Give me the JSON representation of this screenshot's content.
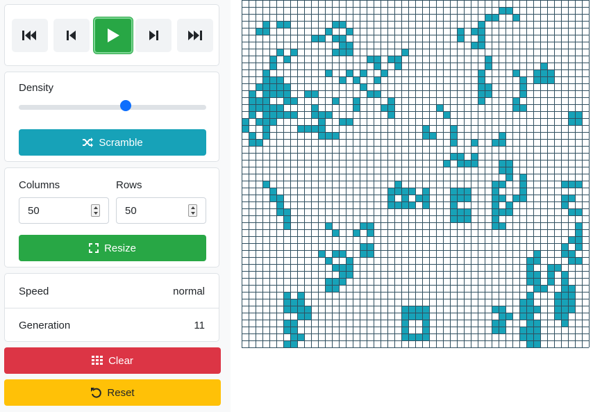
{
  "controls": {
    "icons": [
      "skip-to-start-icon",
      "step-back-icon",
      "play-icon",
      "step-forward-icon",
      "fast-forward-icon"
    ]
  },
  "density": {
    "label": "Density",
    "value_fraction": 0.57,
    "scramble_label": "Scramble"
  },
  "size": {
    "columns_label": "Columns",
    "rows_label": "Rows",
    "columns_value": "50",
    "rows_value": "50",
    "resize_label": "Resize"
  },
  "stats": {
    "speed_label": "Speed",
    "speed_value": "normal",
    "generation_label": "Generation",
    "generation_value": "11"
  },
  "actions": {
    "clear_label": "Clear",
    "reset_label": "Reset"
  },
  "colors": {
    "live_cell": "#17a2b8",
    "grid_line": "#2f4f5f",
    "play_active": "#28a745",
    "scramble": "#17a2b8",
    "resize": "#28a745",
    "clear": "#dc3545",
    "reset": "#ffc107"
  },
  "grid": {
    "columns": 50,
    "rows": 50,
    "live_cells": [
      [
        1,
        37
      ],
      [
        1,
        38
      ],
      [
        2,
        35
      ],
      [
        2,
        36
      ],
      [
        2,
        39
      ],
      [
        3,
        3
      ],
      [
        3,
        5
      ],
      [
        3,
        6
      ],
      [
        3,
        13
      ],
      [
        3,
        14
      ],
      [
        3,
        34
      ],
      [
        4,
        2
      ],
      [
        4,
        3
      ],
      [
        4,
        12
      ],
      [
        4,
        15
      ],
      [
        4,
        31
      ],
      [
        4,
        33
      ],
      [
        4,
        34
      ],
      [
        5,
        10
      ],
      [
        5,
        11
      ],
      [
        5,
        13
      ],
      [
        5,
        14
      ],
      [
        5,
        31
      ],
      [
        5,
        34
      ],
      [
        6,
        14
      ],
      [
        6,
        15
      ],
      [
        6,
        33
      ],
      [
        6,
        34
      ],
      [
        7,
        5
      ],
      [
        7,
        7
      ],
      [
        7,
        13
      ],
      [
        7,
        14
      ],
      [
        7,
        15
      ],
      [
        7,
        23
      ],
      [
        8,
        4
      ],
      [
        8,
        6
      ],
      [
        8,
        18
      ],
      [
        8,
        19
      ],
      [
        8,
        21
      ],
      [
        8,
        22
      ],
      [
        8,
        35
      ],
      [
        9,
        4
      ],
      [
        9,
        19
      ],
      [
        9,
        22
      ],
      [
        9,
        35
      ],
      [
        10,
        3
      ],
      [
        10,
        12
      ],
      [
        10,
        15
      ],
      [
        10,
        17
      ],
      [
        10,
        20
      ],
      [
        10,
        34
      ],
      [
        10,
        39
      ],
      [
        10,
        42
      ],
      [
        10,
        43
      ],
      [
        11,
        3
      ],
      [
        11,
        4
      ],
      [
        11,
        5
      ],
      [
        11,
        14
      ],
      [
        11,
        16
      ],
      [
        11,
        19
      ],
      [
        11,
        34
      ],
      [
        11,
        40
      ],
      [
        11,
        42
      ],
      [
        11,
        43
      ],
      [
        12,
        3
      ],
      [
        12,
        4
      ],
      [
        12,
        5
      ],
      [
        12,
        17
      ],
      [
        12,
        34
      ],
      [
        12,
        35
      ],
      [
        12,
        40
      ],
      [
        13,
        1
      ],
      [
        13,
        3
      ],
      [
        13,
        4
      ],
      [
        13,
        5
      ],
      [
        13,
        6
      ],
      [
        13,
        9
      ],
      [
        13,
        10
      ],
      [
        13,
        18
      ],
      [
        13,
        19
      ],
      [
        13,
        34
      ],
      [
        13,
        35
      ],
      [
        13,
        40
      ],
      [
        14,
        1
      ],
      [
        14,
        3
      ],
      [
        14,
        6
      ],
      [
        14,
        7
      ],
      [
        14,
        13
      ],
      [
        14,
        16
      ],
      [
        14,
        21
      ],
      [
        14,
        34
      ],
      [
        14,
        39
      ],
      [
        15,
        1
      ],
      [
        15,
        2
      ],
      [
        15,
        3
      ],
      [
        15,
        4
      ],
      [
        15,
        5
      ],
      [
        15,
        10
      ],
      [
        15,
        16
      ],
      [
        15,
        20
      ],
      [
        15,
        21
      ],
      [
        15,
        28
      ],
      [
        15,
        39
      ],
      [
        15,
        40
      ],
      [
        16,
        1
      ],
      [
        16,
        3
      ],
      [
        16,
        4
      ],
      [
        16,
        5
      ],
      [
        16,
        6
      ],
      [
        16,
        7
      ],
      [
        16,
        10
      ],
      [
        16,
        11
      ],
      [
        16,
        12
      ],
      [
        16,
        21
      ],
      [
        16,
        29
      ],
      [
        16,
        47
      ],
      [
        16,
        48
      ],
      [
        17,
        0
      ],
      [
        17,
        2
      ],
      [
        17,
        3
      ],
      [
        17,
        4
      ],
      [
        17,
        11
      ],
      [
        17,
        14
      ],
      [
        17,
        15
      ],
      [
        17,
        47
      ],
      [
        17,
        48
      ],
      [
        18,
        0
      ],
      [
        18,
        3
      ],
      [
        18,
        8
      ],
      [
        18,
        9
      ],
      [
        18,
        10
      ],
      [
        18,
        11
      ],
      [
        18,
        26
      ],
      [
        18,
        30
      ],
      [
        19,
        1
      ],
      [
        19,
        3
      ],
      [
        19,
        11
      ],
      [
        19,
        12
      ],
      [
        19,
        13
      ],
      [
        19,
        26
      ],
      [
        19,
        27
      ],
      [
        19,
        30
      ],
      [
        19,
        37
      ],
      [
        20,
        1
      ],
      [
        20,
        2
      ],
      [
        20,
        30
      ],
      [
        20,
        33
      ],
      [
        20,
        36
      ],
      [
        20,
        37
      ],
      [
        22,
        30
      ],
      [
        22,
        31
      ],
      [
        22,
        33
      ],
      [
        23,
        29
      ],
      [
        23,
        31
      ],
      [
        23,
        32
      ],
      [
        23,
        33
      ],
      [
        23,
        37
      ],
      [
        23,
        38
      ],
      [
        24,
        37
      ],
      [
        24,
        38
      ],
      [
        25,
        38
      ],
      [
        25,
        40
      ],
      [
        26,
        3
      ],
      [
        26,
        36
      ],
      [
        26,
        37
      ],
      [
        26,
        40
      ],
      [
        26,
        46
      ],
      [
        26,
        47
      ],
      [
        26,
        48
      ],
      [
        27,
        4
      ],
      [
        27,
        21
      ],
      [
        27,
        22
      ],
      [
        27,
        23
      ],
      [
        27,
        30
      ],
      [
        27,
        31
      ],
      [
        27,
        32
      ],
      [
        27,
        36
      ],
      [
        27,
        40
      ],
      [
        28,
        4
      ],
      [
        28,
        5
      ],
      [
        28,
        21
      ],
      [
        28,
        23
      ],
      [
        28,
        30
      ],
      [
        28,
        31
      ],
      [
        28,
        36
      ],
      [
        28,
        37
      ],
      [
        28,
        39
      ],
      [
        28,
        40
      ],
      [
        28,
        46
      ],
      [
        28,
        47
      ],
      [
        29,
        5
      ],
      [
        29,
        21
      ],
      [
        29,
        22
      ],
      [
        29,
        23
      ],
      [
        29,
        30
      ],
      [
        29,
        36
      ],
      [
        29,
        38
      ],
      [
        29,
        46
      ],
      [
        30,
        5
      ],
      [
        30,
        6
      ],
      [
        30,
        30
      ],
      [
        30,
        31
      ],
      [
        30,
        36
      ],
      [
        30,
        37
      ],
      [
        30,
        38
      ],
      [
        30,
        47
      ],
      [
        30,
        48
      ],
      [
        31,
        6
      ],
      [
        31,
        30
      ],
      [
        31,
        31
      ],
      [
        31,
        36
      ],
      [
        32,
        6
      ],
      [
        32,
        12
      ],
      [
        32,
        17
      ],
      [
        32,
        18
      ],
      [
        32,
        36
      ],
      [
        32,
        37
      ],
      [
        33,
        13
      ],
      [
        33,
        16
      ],
      [
        33,
        18
      ],
      [
        35,
        17
      ],
      [
        35,
        18
      ],
      [
        35,
        46
      ],
      [
        36,
        11
      ],
      [
        36,
        13
      ],
      [
        36,
        14
      ],
      [
        36,
        17
      ],
      [
        36,
        18
      ],
      [
        36,
        46
      ],
      [
        36,
        47
      ],
      [
        37,
        12
      ],
      [
        37,
        15
      ],
      [
        37,
        41
      ],
      [
        37,
        47
      ],
      [
        37,
        48
      ],
      [
        38,
        13
      ],
      [
        38,
        14
      ],
      [
        38,
        15
      ],
      [
        38,
        41
      ],
      [
        39,
        14
      ],
      [
        39,
        15
      ],
      [
        39,
        41
      ],
      [
        39,
        42
      ],
      [
        40,
        13
      ],
      [
        40,
        14
      ],
      [
        40,
        41
      ],
      [
        40,
        42
      ],
      [
        41,
        12
      ],
      [
        41,
        13
      ],
      [
        41,
        42
      ],
      [
        41,
        43
      ],
      [
        42,
        6
      ],
      [
        42,
        8
      ],
      [
        42,
        41
      ],
      [
        43,
        6
      ],
      [
        43,
        7
      ],
      [
        43,
        8
      ],
      [
        43,
        40
      ],
      [
        43,
        41
      ],
      [
        44,
        6
      ],
      [
        44,
        7
      ],
      [
        44,
        8
      ],
      [
        44,
        9
      ],
      [
        44,
        36
      ],
      [
        44,
        37
      ],
      [
        44,
        40
      ],
      [
        44,
        41
      ],
      [
        44,
        42
      ],
      [
        45,
        8
      ],
      [
        45,
        9
      ],
      [
        45,
        37
      ],
      [
        45,
        38
      ],
      [
        45,
        40
      ],
      [
        45,
        41
      ],
      [
        46,
        6
      ],
      [
        46,
        7
      ],
      [
        46,
        36
      ],
      [
        46,
        37
      ],
      [
        46,
        41
      ],
      [
        46,
        42
      ],
      [
        47,
        6
      ],
      [
        47,
        7
      ],
      [
        47,
        36
      ],
      [
        47,
        37
      ],
      [
        47,
        40
      ],
      [
        47,
        41
      ],
      [
        47,
        42
      ],
      [
        48,
        7
      ],
      [
        48,
        8
      ],
      [
        48,
        40
      ],
      [
        48,
        41
      ],
      [
        48,
        42
      ],
      [
        49,
        6
      ],
      [
        49,
        7
      ],
      [
        49,
        41
      ],
      [
        49,
        42
      ],
      [
        12,
        2
      ],
      [
        12,
        6
      ],
      [
        14,
        2
      ],
      [
        9,
        43
      ],
      [
        10,
        44
      ],
      [
        11,
        44
      ],
      [
        27,
        31
      ],
      [
        28,
        32
      ],
      [
        30,
        32
      ],
      [
        31,
        32
      ],
      [
        34,
        47
      ],
      [
        35,
        48
      ],
      [
        36,
        42
      ],
      [
        37,
        42
      ],
      [
        39,
        46
      ],
      [
        40,
        46
      ],
      [
        41,
        46
      ],
      [
        41,
        47
      ],
      [
        42,
        46
      ],
      [
        42,
        47
      ],
      [
        43,
        46
      ],
      [
        43,
        47
      ],
      [
        44,
        46
      ],
      [
        44,
        47
      ],
      [
        44,
        45
      ],
      [
        45,
        45
      ],
      [
        45,
        46
      ],
      [
        46,
        46
      ],
      [
        38,
        44
      ],
      [
        38,
        45
      ],
      [
        39,
        44
      ],
      [
        40,
        44
      ],
      [
        42,
        45
      ],
      [
        43,
        45
      ],
      [
        32,
        48
      ],
      [
        33,
        48
      ],
      [
        34,
        48
      ],
      [
        26,
        22
      ],
      [
        27,
        24
      ],
      [
        28,
        25
      ],
      [
        29,
        24
      ],
      [
        28,
        26
      ],
      [
        29,
        26
      ],
      [
        27,
        26
      ],
      [
        44,
        23
      ],
      [
        45,
        23
      ],
      [
        45,
        24
      ],
      [
        45,
        25
      ],
      [
        45,
        26
      ],
      [
        46,
        23
      ],
      [
        46,
        26
      ],
      [
        47,
        23
      ],
      [
        47,
        26
      ],
      [
        48,
        23
      ],
      [
        48,
        24
      ],
      [
        48,
        25
      ],
      [
        48,
        26
      ],
      [
        44,
        24
      ],
      [
        44,
        25
      ],
      [
        44,
        26
      ],
      [
        41,
        12
      ],
      [
        40,
        12
      ]
    ]
  }
}
